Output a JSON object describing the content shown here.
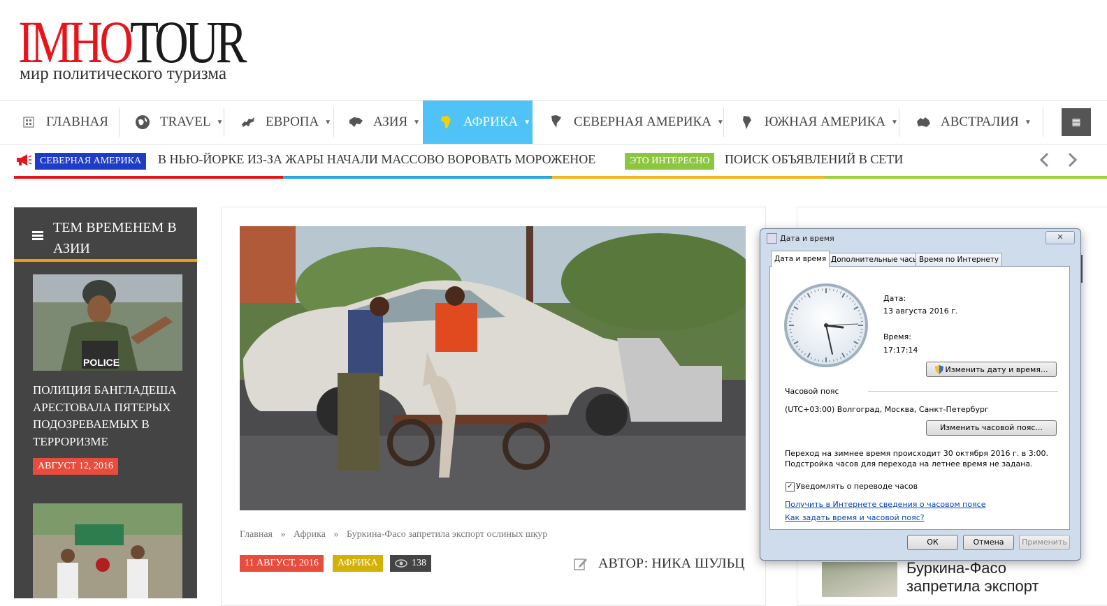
{
  "header": {
    "logo_red": "IMHO",
    "logo_black": "TOUR",
    "tagline": "мир политического туризма"
  },
  "nav": {
    "items": [
      {
        "label": "ГЛАВНАЯ",
        "icon": "home-icon"
      },
      {
        "label": "TRAVEL",
        "icon": "globe-icon"
      },
      {
        "label": "ЕВРОПА",
        "icon": "europe-map-icon"
      },
      {
        "label": "АЗИЯ",
        "icon": "asia-map-icon"
      },
      {
        "label": "АФРИКА",
        "icon": "africa-map-icon",
        "active": true
      },
      {
        "label": "СЕВЕРНАЯ АМЕРИКА",
        "icon": "north-america-map-icon"
      },
      {
        "label": "ЮЖНАЯ АМЕРИКА",
        "icon": "south-america-map-icon"
      },
      {
        "label": "АВСТРАЛИЯ",
        "icon": "australia-map-icon"
      }
    ]
  },
  "ticker": {
    "items": [
      {
        "category": "СЕВЕРНАЯ АМЕРИКА",
        "category_color": "#1e3cc8",
        "title": "В НЬЮ-ЙОРКЕ ИЗ-ЗА ЖАРЫ НАЧАЛИ МАССОВО ВОРОВАТЬ МОРОЖЕНОЕ"
      },
      {
        "category": "ЭТО ИНТЕРЕСНО",
        "category_color": "#8cc63f",
        "title": "ПОИСК ОБЪЯВЛЕНИЙ В СЕТИ"
      }
    ],
    "stripe_colors": [
      "#e8141c",
      "#29a8e0",
      "#f3b61f",
      "#9bd13a"
    ]
  },
  "sidebar": {
    "title": "ТЕМ ВРЕМЕНЕМ В АЗИИ",
    "article_title": "ПОЛИЦИЯ БАНГЛАДЕША АРЕСТОВАЛА ПЯТЕРЫХ ПОДОЗРЕВАЕМЫХ В ТЕРРОРИЗМЕ",
    "article_date": "АВГУСТ 12, 2016",
    "image_text": "POLICE"
  },
  "article": {
    "breadcrumb": [
      "Главная",
      "Африка",
      "Буркина-Фасо запретила экспорт ослиных шкур"
    ],
    "breadcrumb_sep": "»",
    "date": "11 АВГУСТ, 2016",
    "category": "АФРИКА",
    "views": "138",
    "author": "АВТОР: НИКА ШУЛЬЦ"
  },
  "right": {
    "title": "Буркина-Фасо запретила экспорт"
  },
  "dialog": {
    "title": "Дата и время",
    "close": "✕",
    "tabs": [
      "Дата и время",
      "Дополнительные часы",
      "Время по Интернету"
    ],
    "date_label": "Дата:",
    "date_value": "13 августа 2016 г.",
    "time_label": "Время:",
    "time_value": "17:17:14",
    "change_datetime": "Изменить дату и время...",
    "tz_label": "Часовой пояс",
    "tz_value": "(UTC+03:00) Волгоград, Москва, Санкт-Петербург",
    "change_tz": "Изменить часовой пояс...",
    "dst_line1": "Переход на зимнее время происходит 30 октября 2016 г. в 3:00.",
    "dst_line2": "Подстройка часов для перехода на летнее время не задана.",
    "notify_label": "Уведомлять о переводе часов",
    "notify_checked": true,
    "link1": "Получить в Интернете сведения о часовом поясе",
    "link2": "Как задать время и часовой пояс?",
    "ok": "ОК",
    "cancel": "Отмена",
    "apply": "Применить"
  }
}
